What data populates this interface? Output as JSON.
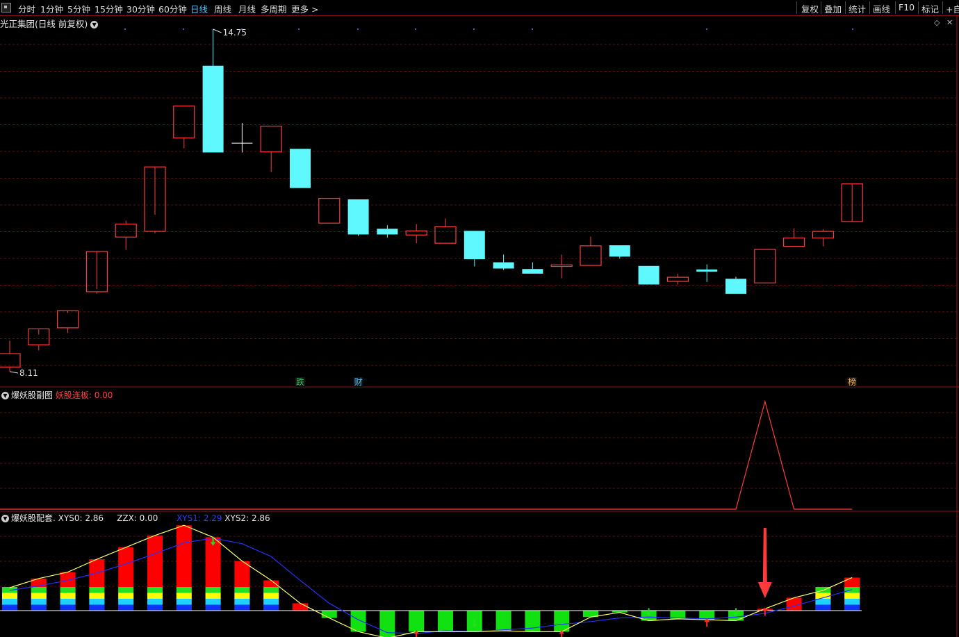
{
  "toolbar": {
    "periods": [
      "分时",
      "1分钟",
      "5分钟",
      "15分钟",
      "30分钟",
      "60分钟",
      "日线",
      "周线",
      "月线",
      "多周期",
      "更多 >"
    ],
    "active_period": "日线",
    "right_buttons": [
      "复权",
      "叠加",
      "统计",
      "画线",
      "F10",
      "标记",
      "+自选"
    ]
  },
  "title": "光正集团(日线 前复权)",
  "markers": {
    "high_label": "14.75",
    "low_label": "8.11"
  },
  "events": [
    {
      "label": "跌",
      "bar": 10,
      "color": "#22c55e"
    },
    {
      "label": "财",
      "bar": 12,
      "color": "#4fc3ff"
    },
    {
      "label": "榜",
      "bar": 29,
      "color": "#ffb24d"
    }
  ],
  "sub1": {
    "name": "爆妖股副图",
    "metric_label": "妖股连板",
    "metric_value": "0.00"
  },
  "sub2": {
    "name": "爆妖股配套",
    "xys0_label": "XYS0",
    "xys0_value": "2.86",
    "zzx_label": "ZZX",
    "zzx_value": "0.00",
    "xys1_label": "XYS1",
    "xys1_value": "2.29",
    "xys2_label": "XYS2",
    "xys2_value": "2.86"
  },
  "colors": {
    "up": "#ff3b3b",
    "down": "#5ff8ff",
    "grid": "#5a1010",
    "cross": "#ffffff"
  },
  "chart_data": [
    {
      "type": "candlestick",
      "ylim": [
        8.11,
        14.75
      ],
      "candles": [
        {
          "o": 8.2,
          "h": 8.71,
          "l": 8.11,
          "c": 8.46
        },
        {
          "o": 8.63,
          "h": 8.83,
          "l": 8.52,
          "c": 8.94
        },
        {
          "o": 8.96,
          "h": 9.25,
          "l": 8.86,
          "c": 9.29
        },
        {
          "o": 9.66,
          "h": 9.71,
          "l": 9.62,
          "c": 10.44
        },
        {
          "o": 10.72,
          "h": 11.04,
          "l": 10.47,
          "c": 10.97
        },
        {
          "o": 10.83,
          "h": 11.15,
          "l": 10.79,
          "c": 12.08
        },
        {
          "o": 12.64,
          "h": 13.26,
          "l": 12.44,
          "c": 13.26
        },
        {
          "o": 14.04,
          "h": 14.75,
          "l": 12.36,
          "c": 12.36
        },
        {
          "o": 12.54,
          "h": 12.93,
          "l": 12.36,
          "c": 12.54
        },
        {
          "o": 12.37,
          "h": 12.87,
          "l": 11.98,
          "c": 12.87
        },
        {
          "o": 12.43,
          "h": 12.43,
          "l": 11.67,
          "c": 11.67
        },
        {
          "o": 10.99,
          "h": 11.47,
          "l": 10.99,
          "c": 11.47
        },
        {
          "o": 11.45,
          "h": 11.45,
          "l": 10.74,
          "c": 10.77
        },
        {
          "o": 10.88,
          "h": 10.95,
          "l": 10.71,
          "c": 10.77
        },
        {
          "o": 10.76,
          "h": 10.97,
          "l": 10.6,
          "c": 10.84
        },
        {
          "o": 10.6,
          "h": 11.08,
          "l": 10.6,
          "c": 10.92
        },
        {
          "o": 10.84,
          "h": 10.84,
          "l": 10.15,
          "c": 10.29
        },
        {
          "o": 10.23,
          "h": 10.38,
          "l": 10.08,
          "c": 10.11
        },
        {
          "o": 10.1,
          "h": 10.23,
          "l": 10.06,
          "c": 10.01
        },
        {
          "o": 10.15,
          "h": 10.38,
          "l": 9.92,
          "c": 10.18
        },
        {
          "o": 10.17,
          "h": 10.73,
          "l": 10.17,
          "c": 10.55
        },
        {
          "o": 10.56,
          "h": 10.56,
          "l": 10.3,
          "c": 10.34
        },
        {
          "o": 10.16,
          "h": 10.16,
          "l": 9.8,
          "c": 9.8
        },
        {
          "o": 9.86,
          "h": 10.01,
          "l": 9.8,
          "c": 9.94
        },
        {
          "o": 10.09,
          "h": 10.19,
          "l": 9.85,
          "c": 10.05
        },
        {
          "o": 9.91,
          "h": 9.95,
          "l": 9.62,
          "c": 9.62
        },
        {
          "o": 9.83,
          "h": 10.48,
          "l": 9.83,
          "c": 10.48
        },
        {
          "o": 10.54,
          "h": 10.89,
          "l": 10.54,
          "c": 10.7
        },
        {
          "o": 10.7,
          "h": 10.87,
          "l": 10.54,
          "c": 10.83
        },
        {
          "o": 11.02,
          "h": 11.02,
          "l": 11.02,
          "c": 11.75
        }
      ]
    },
    {
      "type": "line",
      "title": "爆妖股副图",
      "series": [
        {
          "name": "妖股连板",
          "values": [
            0,
            0,
            0,
            0,
            0,
            0,
            0,
            0,
            0,
            0,
            0,
            0,
            0,
            0,
            0,
            0,
            0,
            0,
            0,
            0,
            0,
            0,
            0,
            0,
            0,
            0,
            1,
            0,
            0,
            0
          ]
        }
      ]
    },
    {
      "type": "bar",
      "title": "爆妖股配套",
      "series": [
        {
          "name": "XYS0",
          "values": [
            2.5,
            3.5,
            4.2,
            5.6,
            6.9,
            8.2,
            9.3,
            8.0,
            5.4,
            3.3,
            0.8,
            -0.8,
            -2.3,
            -3.0,
            -2.3,
            -2.3,
            -2.3,
            -2.2,
            -2.3,
            -2.3,
            -0.7,
            -0.2,
            -1.1,
            -0.9,
            -1.0,
            -1.1,
            0.2,
            1.4,
            2.2,
            3.6
          ]
        },
        {
          "name": "XYS1",
          "values": [
            2.2,
            2.7,
            3.3,
            4.1,
            5.1,
            6.2,
            7.4,
            7.9,
            7.3,
            5.9,
            3.3,
            0.8,
            -1.0,
            -2.4,
            -2.5,
            -2.2,
            -2.3,
            -2.1,
            -1.9,
            -1.5,
            -1.2,
            -0.8,
            -0.7,
            -0.8,
            -0.9,
            -0.7,
            -0.3,
            0.5,
            1.4,
            2.3
          ]
        },
        {
          "name": "XYS2",
          "values": [
            2.5,
            3.5,
            4.2,
            5.6,
            6.9,
            8.2,
            9.3,
            8.0,
            5.4,
            3.3,
            0.8,
            -0.8,
            -2.3,
            -3.0,
            -2.3,
            -2.3,
            -2.3,
            -2.2,
            -2.3,
            -2.3,
            -0.7,
            -0.2,
            -1.1,
            -0.9,
            -1.0,
            -1.1,
            0.2,
            1.4,
            2.2,
            3.6
          ]
        }
      ],
      "signals": {
        "up": [
          14,
          19,
          24,
          26
        ],
        "down": [
          7,
          16,
          22,
          25
        ]
      }
    }
  ]
}
